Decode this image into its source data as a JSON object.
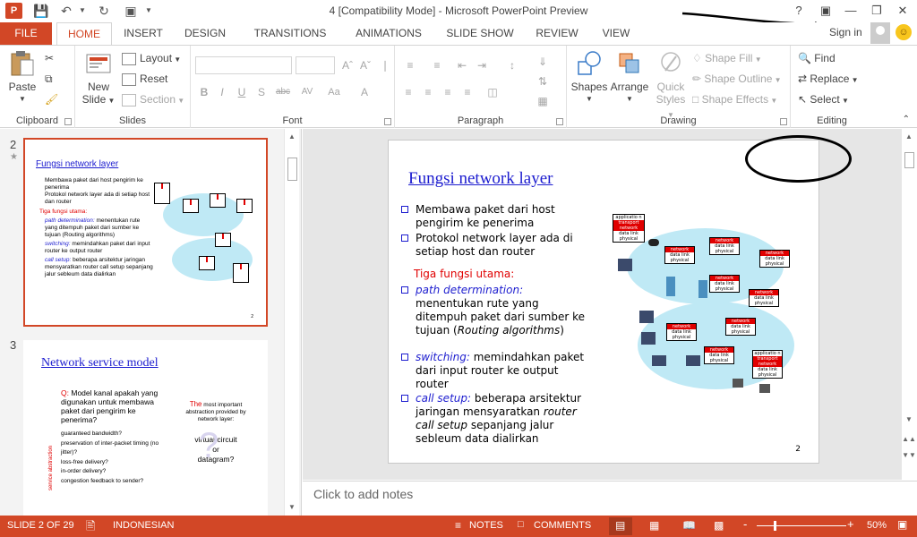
{
  "window": {
    "title": "4 [Compatibility Mode] - Microsoft PowerPoint Preview",
    "app_icon": "P",
    "help": "?"
  },
  "tabs": [
    "FILE",
    "HOME",
    "INSERT",
    "DESIGN",
    "TRANSITIONS",
    "ANIMATIONS",
    "SLIDE SHOW",
    "REVIEW",
    "VIEW"
  ],
  "active_tab": "HOME",
  "account": {
    "signin": "Sign in"
  },
  "ribbon": {
    "clipboard": {
      "label": "Clipboard",
      "paste": "Paste"
    },
    "slides": {
      "label": "Slides",
      "new_slide_1": "New",
      "new_slide_2": "Slide",
      "layout": "Layout",
      "reset": "Reset",
      "section": "Section"
    },
    "font": {
      "label": "Font",
      "bold": "B",
      "italic": "I",
      "underline": "U",
      "shadow": "S",
      "strike": "abc",
      "spacing": "AV",
      "case": "Aa"
    },
    "paragraph": {
      "label": "Paragraph"
    },
    "drawing": {
      "label": "Drawing",
      "shapes": "Shapes",
      "arrange": "Arrange",
      "quick_1": "Quick",
      "quick_2": "Styles",
      "shape_fill": "Shape Fill",
      "shape_outline": "Shape Outline",
      "shape_effects": "Shape Effects"
    },
    "editing": {
      "label": "Editing",
      "find": "Find",
      "replace": "Replace",
      "select": "Select"
    }
  },
  "thumbnails": [
    {
      "number": "2",
      "title": "Fungsi network layer",
      "lines": [
        "Membawa paket dari host pengirim ke penerima",
        "Protokol network layer ada di setiap host dan router"
      ],
      "sub_title": "Tiga fungsi utama:",
      "items": [
        {
          "term": "path determination:",
          "text": "menentukan rute yang ditempuh paket dari sumber ke tujuan (Routing algorithms)"
        },
        {
          "term": "switching:",
          "text": "memindahkan paket dari input router ke output router"
        },
        {
          "term": "call setup:",
          "text": "beberapa arsitektur jaringan mensyaratkan router call setup sepanjang jalur sebleum data dialirkan"
        }
      ],
      "page": "2"
    },
    {
      "number": "3",
      "title": "Network service model",
      "question_q": "Q:",
      "question": "Model kanal apakah yang digunakan untuk membawa paket dari pengirim ke penerima?",
      "items": [
        "guaranteed bandwidth?",
        "preservation of inter-packet timing (no jitter)?",
        "loss-free delivery?",
        "in-order delivery?",
        "congestion feedback to sender?"
      ],
      "side_label": "service abstraction",
      "note_the": "The",
      "note": "most important abstraction provided by network layer:",
      "vc1": "virtual circuit",
      "vc2": "or",
      "vc3": "datagram?"
    }
  ],
  "slide": {
    "title": "Fungsi network layer",
    "bullets": [
      "Membawa paket dari host pengirim ke penerima",
      "Protokol network layer ada di setiap host dan router"
    ],
    "sub_title": "Tiga fungsi utama:",
    "items": [
      {
        "term": "path determination:",
        "text": "menentukan rute yang ditempuh paket dari sumber ke tujuan (",
        "term2": "Routing algorithms",
        "text2": ")"
      },
      {
        "term": "switching:",
        "text": " memindahkan paket dari input router ke output router"
      },
      {
        "term": "call setup:",
        "text": " beberapa arsitektur jaringan mensyaratkan ",
        "term2": "router call setup",
        "text2": " sepanjang jalur sebleum data dialirkan"
      }
    ],
    "diagram": {
      "application": "applicatio n",
      "transport": "transport",
      "network": "network",
      "data_link": "data link",
      "physical": "physical"
    },
    "page": "2"
  },
  "notes_placeholder": "Click to add notes",
  "status": {
    "slide_info": "SLIDE 2 OF 29",
    "language": "INDONESIAN",
    "notes": "NOTES",
    "comments": "COMMENTS",
    "zoom_minus": "-",
    "zoom_plus": "+",
    "zoom": "50%"
  }
}
